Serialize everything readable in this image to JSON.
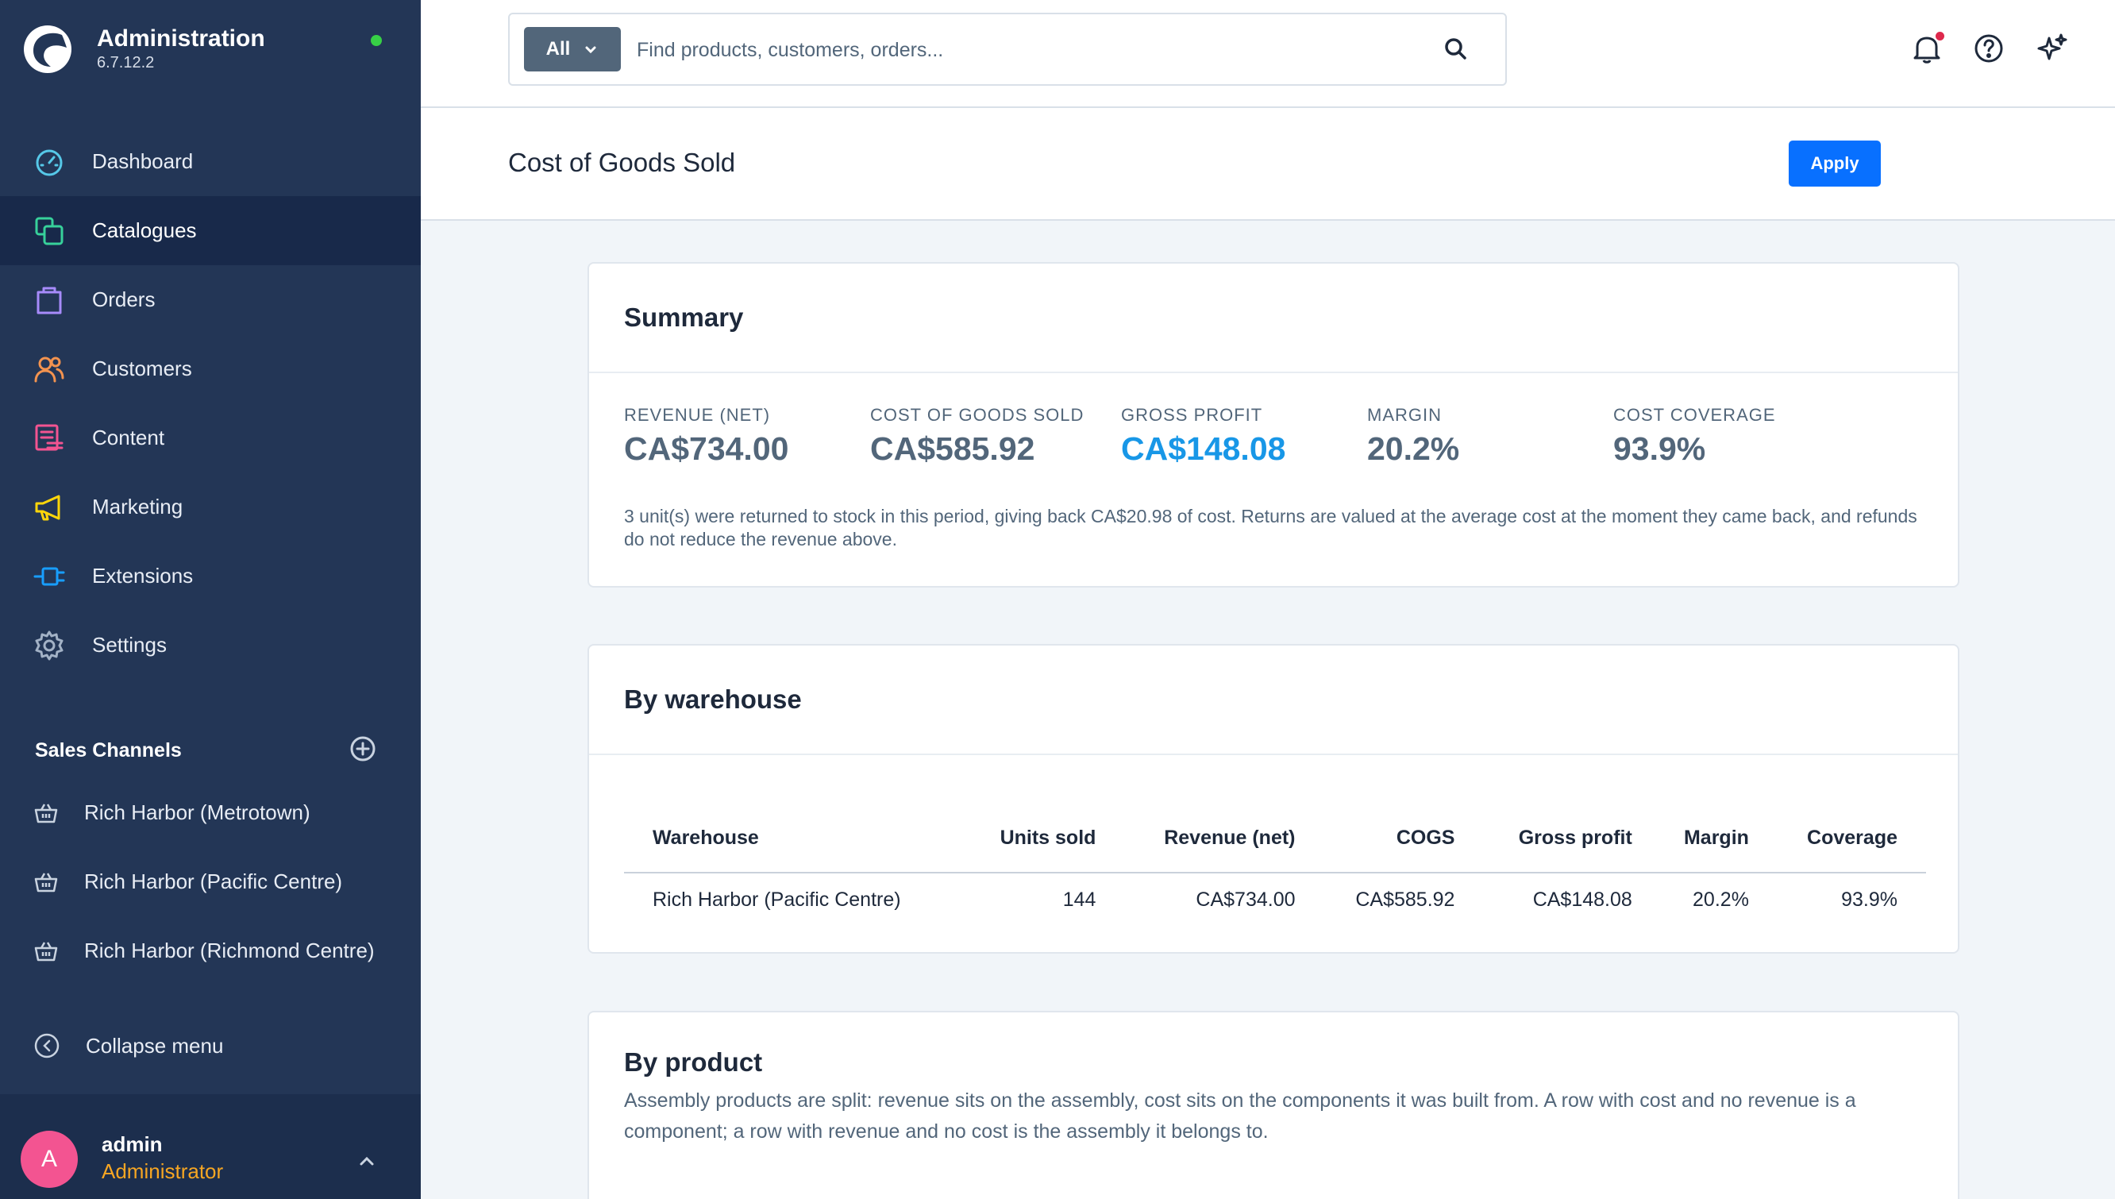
{
  "app": {
    "title": "Administration",
    "version": "6.7.12.2"
  },
  "nav": {
    "items": [
      {
        "label": "Dashboard",
        "icon": "dashboard-icon",
        "color": "#56c8e8"
      },
      {
        "label": "Catalogues",
        "icon": "catalogues-icon",
        "color": "#37d19b",
        "active": true
      },
      {
        "label": "Orders",
        "icon": "orders-icon",
        "color": "#a78bfa"
      },
      {
        "label": "Customers",
        "icon": "customers-icon",
        "color": "#f3934f"
      },
      {
        "label": "Content",
        "icon": "content-icon",
        "color": "#f35491"
      },
      {
        "label": "Marketing",
        "icon": "marketing-icon",
        "color": "#ffd60a"
      },
      {
        "label": "Extensions",
        "icon": "extensions-icon",
        "color": "#189eff"
      },
      {
        "label": "Settings",
        "icon": "settings-icon",
        "color": "#a3b2c6"
      }
    ]
  },
  "sales_channels": {
    "title": "Sales Channels",
    "items": [
      {
        "label": "Rich Harbor (Metrotown)"
      },
      {
        "label": "Rich Harbor (Pacific Centre)"
      },
      {
        "label": "Rich Harbor (Richmond Centre)"
      }
    ]
  },
  "collapse_label": "Collapse menu",
  "user": {
    "initial": "A",
    "name": "admin",
    "role": "Administrator"
  },
  "search": {
    "type_label": "All",
    "placeholder": "Find products, customers, orders..."
  },
  "page": {
    "title": "Cost of Goods Sold",
    "apply_label": "Apply"
  },
  "summary": {
    "title": "Summary",
    "metrics": [
      {
        "label": "REVENUE (NET)",
        "value": "CA$734.00"
      },
      {
        "label": "COST OF GOODS SOLD",
        "value": "CA$585.92"
      },
      {
        "label": "GROSS PROFIT",
        "value": "CA$148.08"
      },
      {
        "label": "MARGIN",
        "value": "20.2%"
      },
      {
        "label": "COST COVERAGE",
        "value": "93.9%"
      }
    ],
    "note": "3 unit(s) were returned to stock in this period, giving back CA$20.98 of cost. Returns are valued at the average cost at the moment they came back, and refunds do not reduce the revenue above."
  },
  "by_warehouse": {
    "title": "By warehouse",
    "columns": [
      "Warehouse",
      "Units sold",
      "Revenue (net)",
      "COGS",
      "Gross profit",
      "Margin",
      "Coverage"
    ],
    "rows": [
      [
        "Rich Harbor (Pacific Centre)",
        "144",
        "CA$734.00",
        "CA$585.92",
        "CA$148.08",
        "20.2%",
        "93.9%"
      ]
    ]
  },
  "by_product": {
    "title": "By product",
    "note": "Assembly products are split: revenue sits on the assembly, cost sits on the components it was built from. A row with cost and no revenue is a component; a row with revenue and no cost is the assembly it belongs to."
  }
}
